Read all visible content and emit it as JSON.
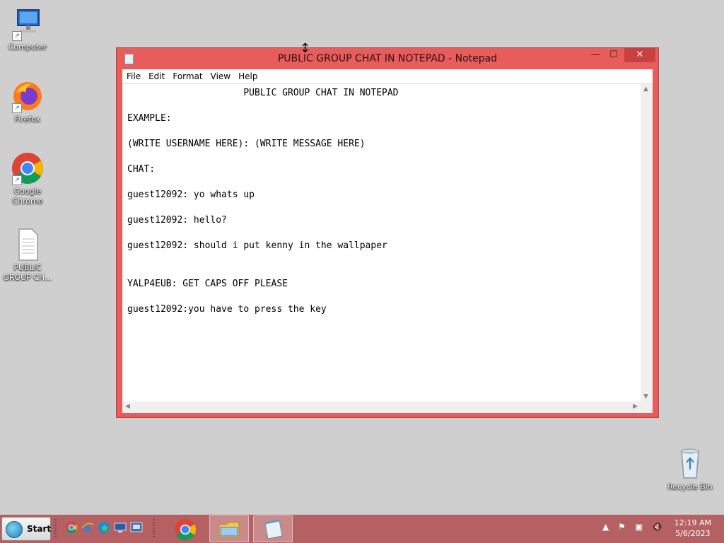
{
  "desktop": {
    "icons": [
      {
        "label": "Computer",
        "icon": "computer-icon"
      },
      {
        "label": "Firefox",
        "icon": "firefox-icon"
      },
      {
        "label": "Google Chrome",
        "icon": "chrome-icon"
      },
      {
        "label": "PUBLIC GROUP CH...",
        "icon": "text-document-icon"
      }
    ],
    "recycle_bin_label": "Recycle Bin"
  },
  "notepad": {
    "title": "PUBLIC GROUP CHAT IN NOTEPAD - Notepad",
    "menu": [
      "File",
      "Edit",
      "Format",
      "View",
      "Help"
    ],
    "content": "                     PUBLIC GROUP CHAT IN NOTEPAD\n\nEXAMPLE:\n\n(WRITE USERNAME HERE): (WRITE MESSAGE HERE)\n\nCHAT:\n\nguest12092: yo whats up\n\nguest12092: hello?\n\nguest12092: should i put kenny in the wallpaper\n\n\nYALP4EUB: GET CAPS OFF PLEASE\n\nguest12092:you have to press the key",
    "min_glyph": "—",
    "max_glyph": "☐",
    "close_glyph": "✕"
  },
  "taskbar": {
    "start_label": "Start",
    "quick_launch": [
      "chrome-icon",
      "ie-icon",
      "edge-icon",
      "desktop-icon",
      "network-icon"
    ],
    "apps": [
      "chrome-icon",
      "file-explorer-icon",
      "notepad-icon"
    ],
    "tray": {
      "time": "12:19 AM",
      "date": "5/6/2023"
    }
  },
  "colors": {
    "window_frame": "#e95c5c",
    "taskbar": "#b56063",
    "desktop": "#cfcfcf"
  }
}
